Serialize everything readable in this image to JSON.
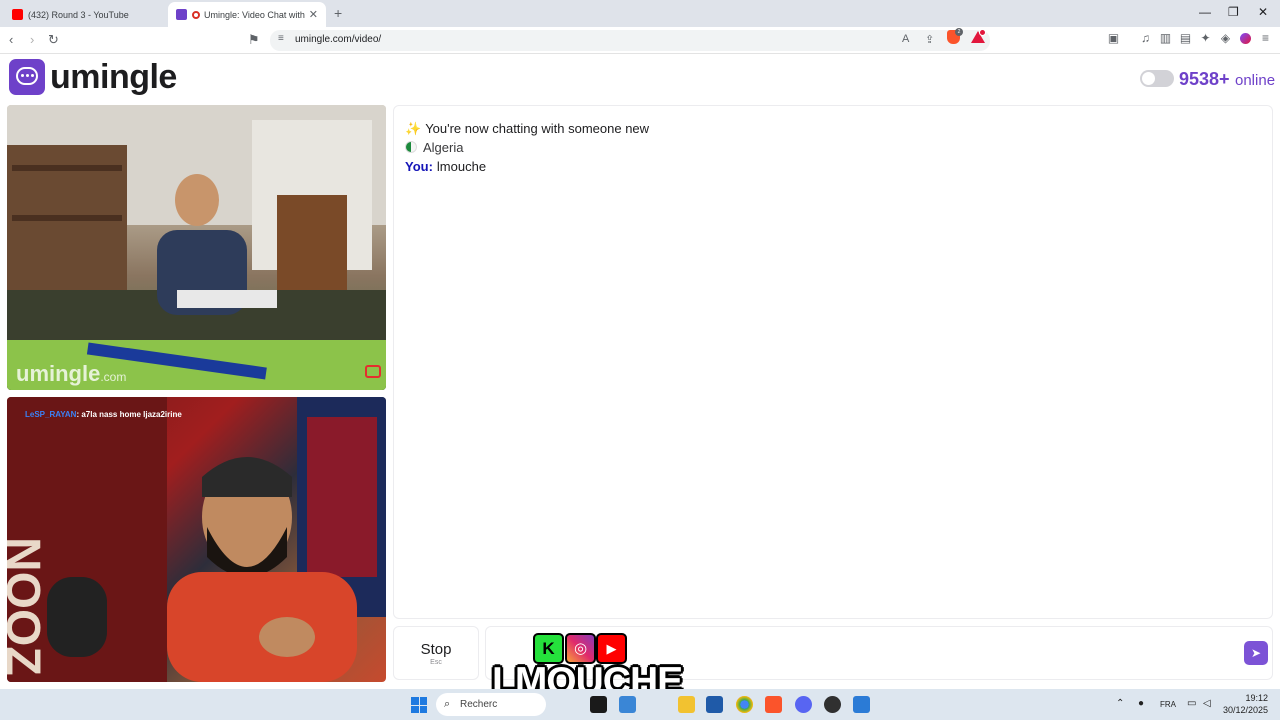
{
  "browser": {
    "tabs": [
      {
        "title": "(432) Round 3 - YouTube",
        "active": false
      },
      {
        "title": "Umingle: Video Chat with Str",
        "active": true
      }
    ],
    "url": "umingle.com/video/",
    "window_controls": {
      "minimize": "—",
      "restore": "❐",
      "close": "✕"
    }
  },
  "header": {
    "logo_text": "umingle",
    "online_count": "9538+",
    "online_label": "online"
  },
  "videos": {
    "stranger_watermark_main": "umingle",
    "stranger_watermark_domain": ".com",
    "self_overlay_name": "LeSP_RAYAN",
    "self_overlay_message": ": a7la nass home ljaza2irine"
  },
  "chat": {
    "system_message": "You're now chatting with someone new",
    "country": "Algeria",
    "you_label": "You:",
    "you_message": "lmouche"
  },
  "controls": {
    "stop_label": "Stop",
    "stop_hint": "Esc",
    "send_icon": "send-icon"
  },
  "overlay": {
    "brand": "LMOUCHE",
    "socials": [
      "K",
      "◎",
      "▶"
    ]
  },
  "taskbar": {
    "search_placeholder": "Recherc",
    "language": "FRA",
    "time": "19:12",
    "date": "30/12/2025"
  },
  "colors": {
    "accent": "#6e41c9",
    "you_label": "#1515b8",
    "send_button": "#7c53d6"
  }
}
